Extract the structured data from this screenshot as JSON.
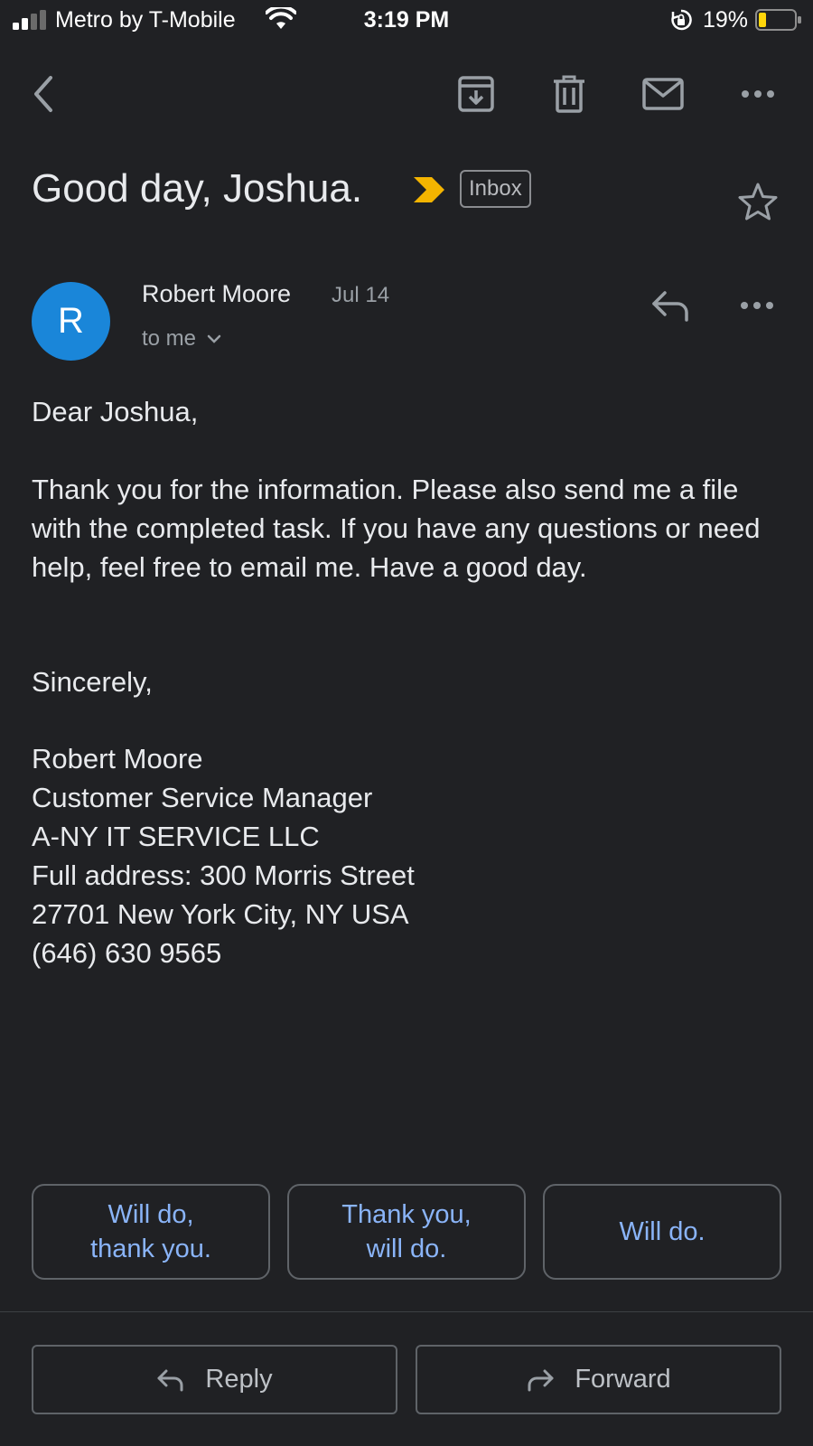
{
  "status_bar": {
    "carrier": "Metro by T-Mobile",
    "time": "3:19 PM",
    "battery_percent": "19%",
    "icons": [
      "signal-icon",
      "wifi-icon",
      "orientation-lock-icon",
      "battery-icon"
    ]
  },
  "toolbar": {
    "icons": [
      "back-icon",
      "archive-icon",
      "delete-icon",
      "mark-unread-icon",
      "more-icon"
    ]
  },
  "email": {
    "subject": "Good day, Joshua.",
    "label": "Inbox",
    "sender": {
      "initial": "R",
      "name": "Robert Moore",
      "date": "Jul 14",
      "recipient": "to me"
    },
    "body": {
      "greeting": "Dear Joshua,",
      "paragraph": "Thank you for the information. Please also send me a file with the completed task. If you have any questions or need help, feel free to email me. Have a good day.",
      "closing": "Sincerely,",
      "signature": [
        "Robert Moore",
        "Customer Service Manager",
        "A-NY IT SERVICE LLC",
        "Full address: 300 Morris Street",
        "27701 New York City, NY USA",
        "(646) 630 9565"
      ]
    }
  },
  "smart_replies": [
    {
      "line1": "Will do,",
      "line2": "thank you."
    },
    {
      "line1": "Thank you,",
      "line2": "will do."
    },
    {
      "line1": "Will do.",
      "line2": ""
    }
  ],
  "actions": {
    "reply_label": "Reply",
    "forward_label": "Forward"
  },
  "colors": {
    "background": "#202124",
    "avatar": "#1a86d9",
    "importance": "#f4b400",
    "link": "#8ab4f8"
  }
}
